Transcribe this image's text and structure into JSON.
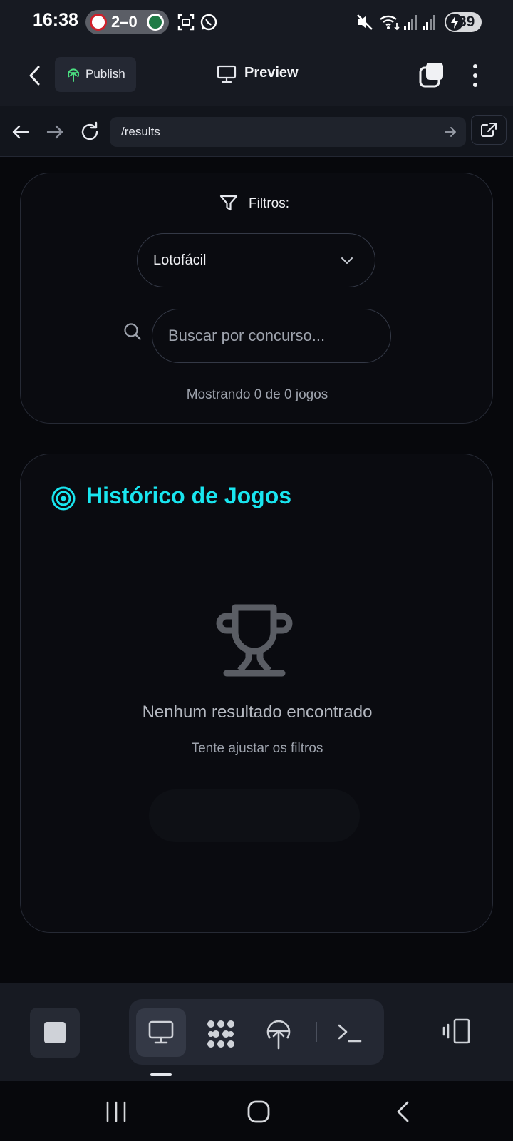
{
  "status_bar": {
    "time": "16:38",
    "score": "2–0",
    "battery": "39"
  },
  "header": {
    "publish_label": "Publish",
    "preview_label": "Preview"
  },
  "url_bar": {
    "path": "/results"
  },
  "filters": {
    "title": "Filtros:",
    "game_select": {
      "selected": "Lotofácil"
    },
    "search": {
      "placeholder": "Buscar por concurso...",
      "value": ""
    },
    "count_text": "Mostrando 0 de 0 jogos"
  },
  "history": {
    "title": "Histórico de Jogos",
    "empty_title": "Nenhum resultado encontrado",
    "empty_subtitle": "Tente ajustar os filtros"
  },
  "bottom_toolbar": {
    "tools": [
      {
        "icon": "monitor-icon",
        "active": true
      },
      {
        "icon": "integrations-icon",
        "active": false
      },
      {
        "icon": "publish-icon",
        "active": false
      },
      {
        "icon": "terminal-icon",
        "active": false
      }
    ]
  },
  "colors": {
    "accent": "#19e6f0",
    "background": "#07080c",
    "card": "#0a0b10",
    "header": "#171a22",
    "publish_green": "#4ade80"
  }
}
